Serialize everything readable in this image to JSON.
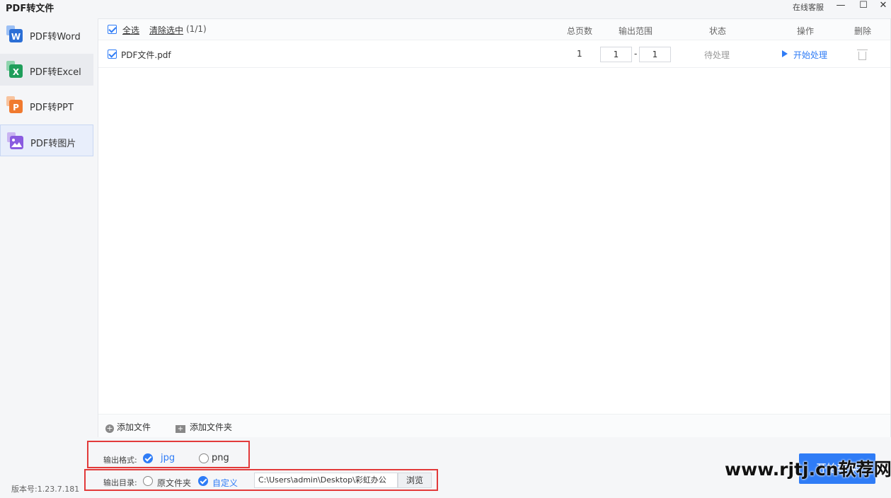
{
  "window": {
    "title": "PDF转文件",
    "online_service": "在线客服",
    "minimize": "—",
    "maximize": "☐",
    "close": "✕"
  },
  "sidebar": {
    "items": [
      {
        "label": "PDF转Word",
        "icon": "word-icon",
        "letter": "W",
        "color": "#2b6fd6"
      },
      {
        "label": "PDF转Excel",
        "icon": "excel-icon",
        "letter": "X",
        "color": "#1f9e5b"
      },
      {
        "label": "PDF转PPT",
        "icon": "ppt-icon",
        "letter": "P",
        "color": "#f07a2f"
      },
      {
        "label": "PDF转图片",
        "icon": "image-icon",
        "letter": "",
        "color": "#8a5be0"
      }
    ],
    "version": "版本号:1.23.7.181"
  },
  "toolbar": {
    "select_all": "全选",
    "clear_selection": "清除选中",
    "selection_count": "(1/1)"
  },
  "columns": {
    "pages": "总页数",
    "range": "输出范围",
    "status": "状态",
    "action": "操作",
    "delete": "删除"
  },
  "files": [
    {
      "name": "PDF文件.pdf",
      "pages": "1",
      "range_from": "1",
      "range_sep": "-",
      "range_to": "1",
      "status": "待处理",
      "action": "开始处理"
    }
  ],
  "footer": {
    "add_file": "添加文件",
    "add_folder": "添加文件夹"
  },
  "output_format": {
    "label": "输出格式:",
    "options": [
      "jpg",
      "png"
    ],
    "selected": "jpg"
  },
  "output_dir": {
    "label": "输出目录:",
    "options": [
      "原文件夹",
      "自定义"
    ],
    "selected": "自定义",
    "path": "C:\\Users\\admin\\Desktop\\彩虹办公",
    "browse": "浏览"
  },
  "start_button": "开始转换",
  "watermark": "www.rjtj.cn软荐网",
  "colors": {
    "accent": "#2f7cf6",
    "highlight_border": "#e23a3a"
  }
}
